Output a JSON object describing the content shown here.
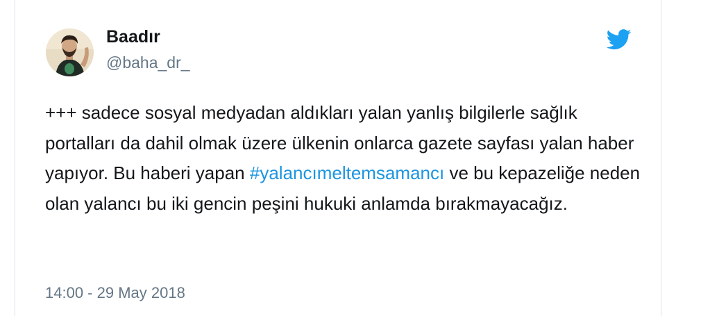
{
  "user": {
    "display_name": "Baadır",
    "handle": "@baha_dr_"
  },
  "tweet": {
    "text_before_hashtag": "+++ sadece sosyal medyadan aldıkları yalan yanlış bilgilerle sağlık portalları da dahil olmak üzere ülkenin onlarca gazete sayfası yalan haber yapıyor. Bu haberi yapan ",
    "hashtag": "#yalancımeltemsamancı",
    "text_after_hashtag": " ve bu kepazeliğe neden olan yalancı bu iki gencin peşini hukuki anlamda bırakmayacağız.",
    "timestamp": "14:00 - 29 May 2018"
  },
  "icons": {
    "brand": "twitter-bird-icon",
    "avatar": "user-avatar"
  },
  "colors": {
    "brand_blue": "#1da1f2",
    "link_blue": "#1b95e0",
    "text_primary": "#14171a",
    "text_secondary": "#657786",
    "border": "#d9e1e8"
  }
}
